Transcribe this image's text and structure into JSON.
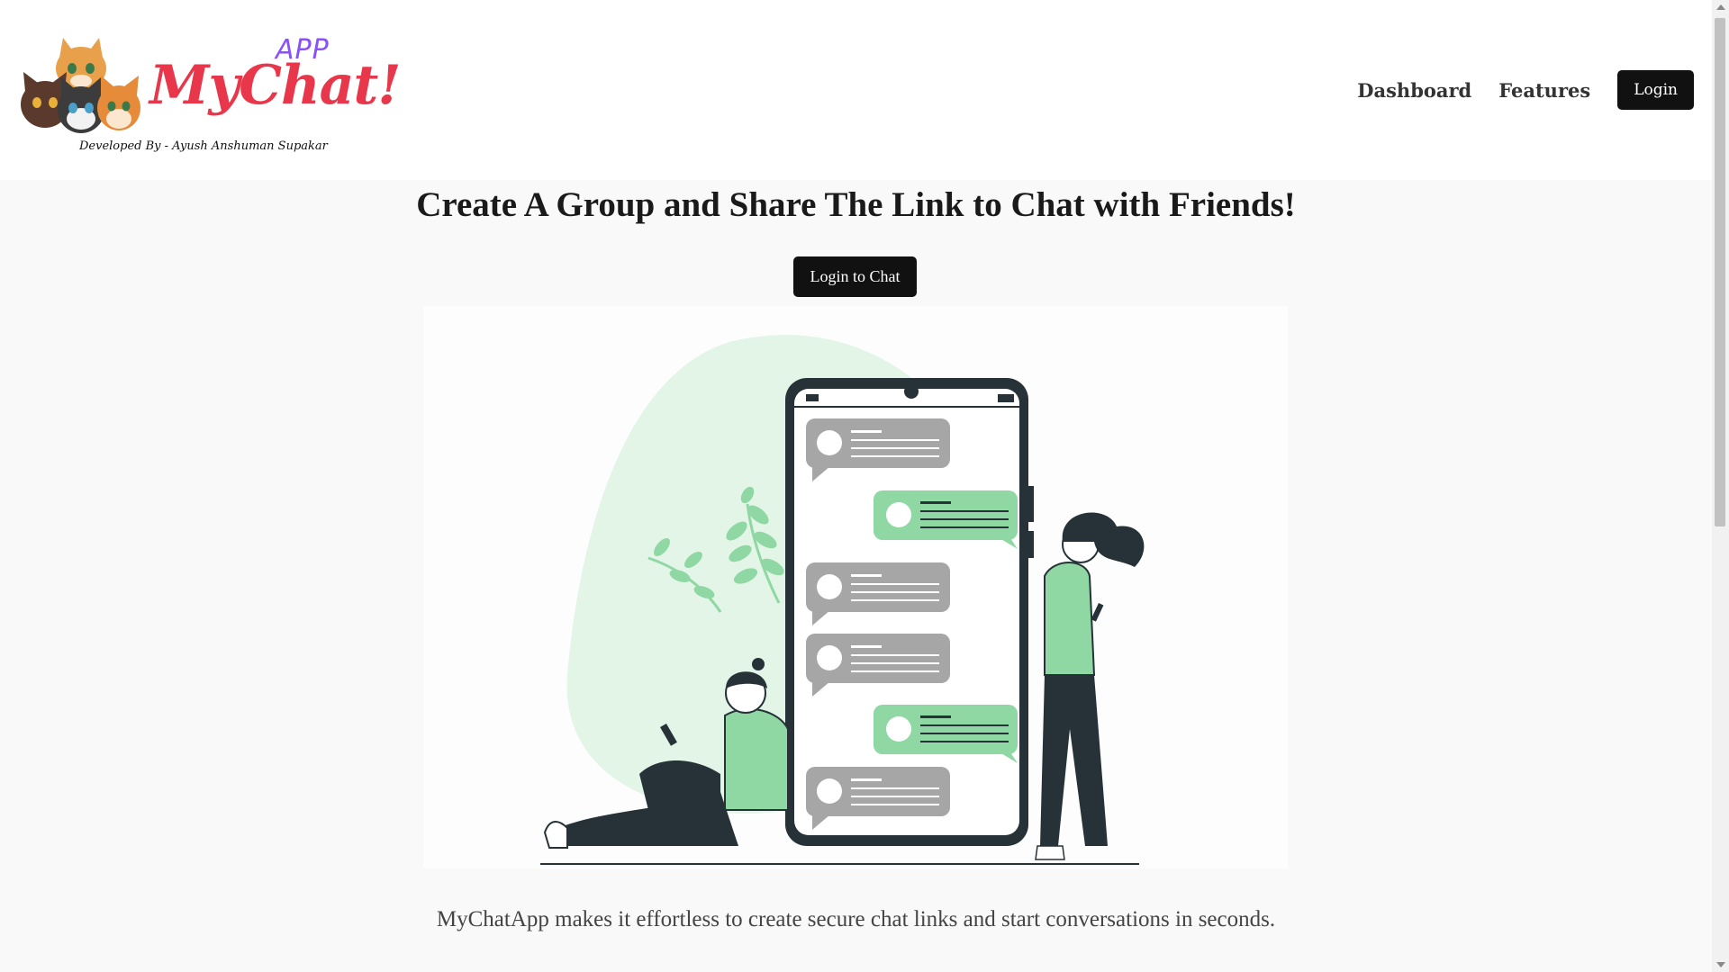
{
  "header": {
    "logo": {
      "app_badge": "APP",
      "title": "MyChat!",
      "credit": "Developed By - Ayush Anshuman Supakar"
    },
    "nav": {
      "dashboard": "Dashboard",
      "features": "Features",
      "login": "Login"
    }
  },
  "hero": {
    "title": "Create A Group and Share The Link to Chat with Friends!",
    "cta_label": "Login to Chat",
    "tagline": "MyChatApp makes it effortless to create secure chat links and start conversations in seconds."
  },
  "colors": {
    "brand_red": "#e8374a",
    "brand_purple": "#8a4fff",
    "accent_green": "#8fd8a4",
    "dark": "#111111"
  },
  "icons": {
    "logo": "cats-logo-icon",
    "illustration": "chat-phone-illustration"
  }
}
